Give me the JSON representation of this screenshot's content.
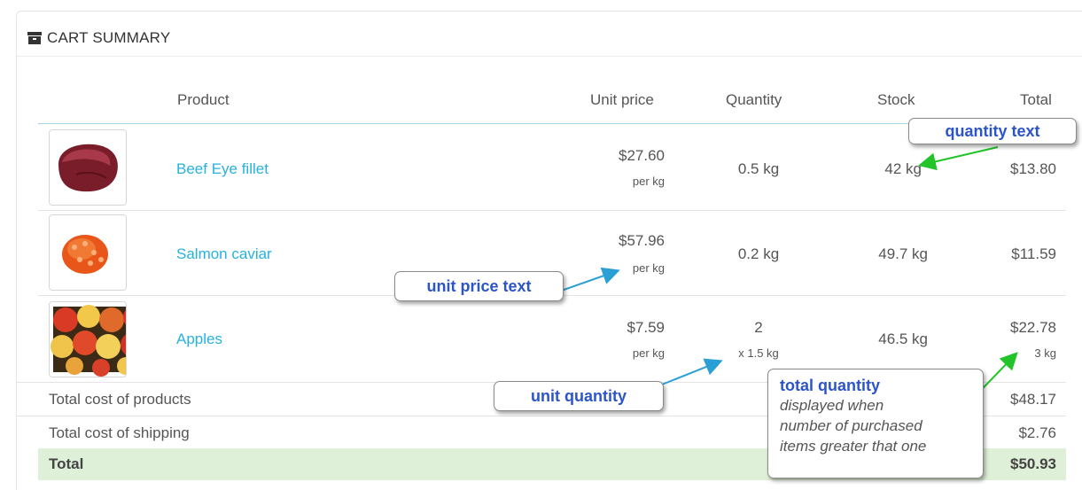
{
  "panel": {
    "title": "CART SUMMARY",
    "icon": "cart-icon"
  },
  "columns": {
    "product": "Product",
    "unit_price": "Unit price",
    "quantity": "Quantity",
    "stock": "Stock",
    "total": "Total"
  },
  "items": [
    {
      "name": "Beef Eye fillet",
      "image": "beef-image",
      "unit_price": "$27.60",
      "unit_price_unit": "per kg",
      "quantity": "0.5 kg",
      "quantity_unit": "",
      "stock": "42 kg",
      "total": "$13.80",
      "total_quantity": ""
    },
    {
      "name": "Salmon caviar",
      "image": "caviar-image",
      "unit_price": "$57.96",
      "unit_price_unit": "per kg",
      "quantity": "0.2 kg",
      "quantity_unit": "",
      "stock": "49.7 kg",
      "total": "$11.59",
      "total_quantity": ""
    },
    {
      "name": "Apples",
      "image": "apples-image",
      "unit_price": "$7.59",
      "unit_price_unit": "per kg",
      "quantity": "2",
      "quantity_unit": "x 1.5 kg",
      "stock": "46.5 kg",
      "total": "$22.78",
      "total_quantity": "3 kg"
    }
  ],
  "summary": {
    "products_label": "Total cost of products",
    "products_value": "$48.17",
    "shipping_label": "Total cost of shipping",
    "shipping_value": "$2.76",
    "total_label": "Total",
    "total_value": "$50.93"
  },
  "callouts": {
    "quantity_text": "quantity text",
    "unit_price_text": "unit price text",
    "unit_quantity": "unit quantity",
    "total_quantity_title": "total quantity",
    "total_quantity_desc": [
      "displayed when",
      "number of purchased",
      "items greater that one"
    ]
  },
  "colors": {
    "link": "#27b2de",
    "header_rule": "#9fd4e4",
    "total_bg": "#dff0d8",
    "callout_text": "#2b55c9",
    "arrow_blue": "#2a9fd6",
    "arrow_green": "#22c42a"
  }
}
